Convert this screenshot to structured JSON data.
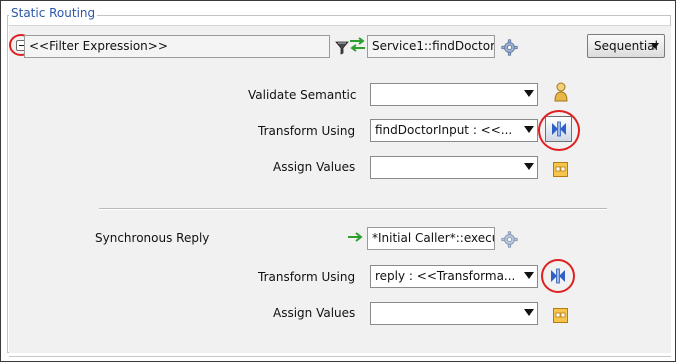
{
  "section": {
    "legend": "Static Routing"
  },
  "filter": {
    "expression": "<<Filter Expression>>"
  },
  "service": {
    "value": "Service1::findDoctor"
  },
  "execution_mode": {
    "value": "Sequential"
  },
  "request": {
    "validate_label": "Validate Semantic",
    "validate_value": "",
    "transform_label": "Transform Using",
    "transform_value": "findDoctorInput : <<...",
    "assign_label": "Assign Values",
    "assign_value": ""
  },
  "reply": {
    "label": "Synchronous Reply",
    "target_value": "*Initial Caller*::execute:ou",
    "transform_label": "Transform Using",
    "transform_value": "reply : <<Transforma...",
    "assign_label": "Assign Values",
    "assign_value": ""
  },
  "colors": {
    "legend": "#2c57a6",
    "highlight_ring": "#e02020",
    "arrow_green": "#2e9e2e",
    "mapper_blue": "#2f5fc4",
    "assign_orange": "#f0a830"
  },
  "icons": {
    "collapse": "collapse-minus-icon",
    "filter": "funnel-filter-icon",
    "routing": "green-bidirectional-arrows-icon",
    "service_lookup": "gear-icon",
    "validate": "schematron-person-icon",
    "mapper": "xsl-mapper-icon",
    "assign": "assign-values-icon",
    "reply_arrow": "green-right-arrow-icon"
  }
}
